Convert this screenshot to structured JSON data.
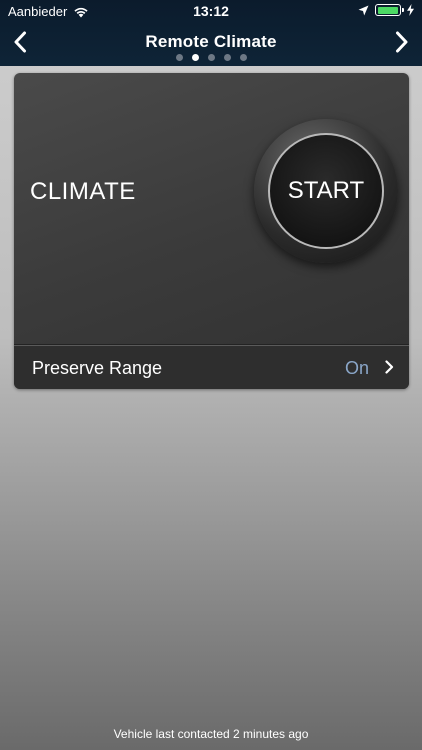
{
  "status_bar": {
    "carrier": "Aanbieder",
    "time": "13:12",
    "battery_level": 1.0,
    "battery_color": "#4cd964"
  },
  "nav": {
    "title": "Remote Climate",
    "prev_icon": "chevron-left-icon",
    "next_icon": "chevron-right-icon",
    "page_count": 5,
    "current_page": 2
  },
  "climate": {
    "label": "CLIMATE",
    "start_button": "START"
  },
  "preserve_range": {
    "label": "Preserve Range",
    "value": "On",
    "value_color": "#8aa6c8"
  },
  "footer": {
    "status": "Vehicle last contacted 2 minutes ago"
  }
}
